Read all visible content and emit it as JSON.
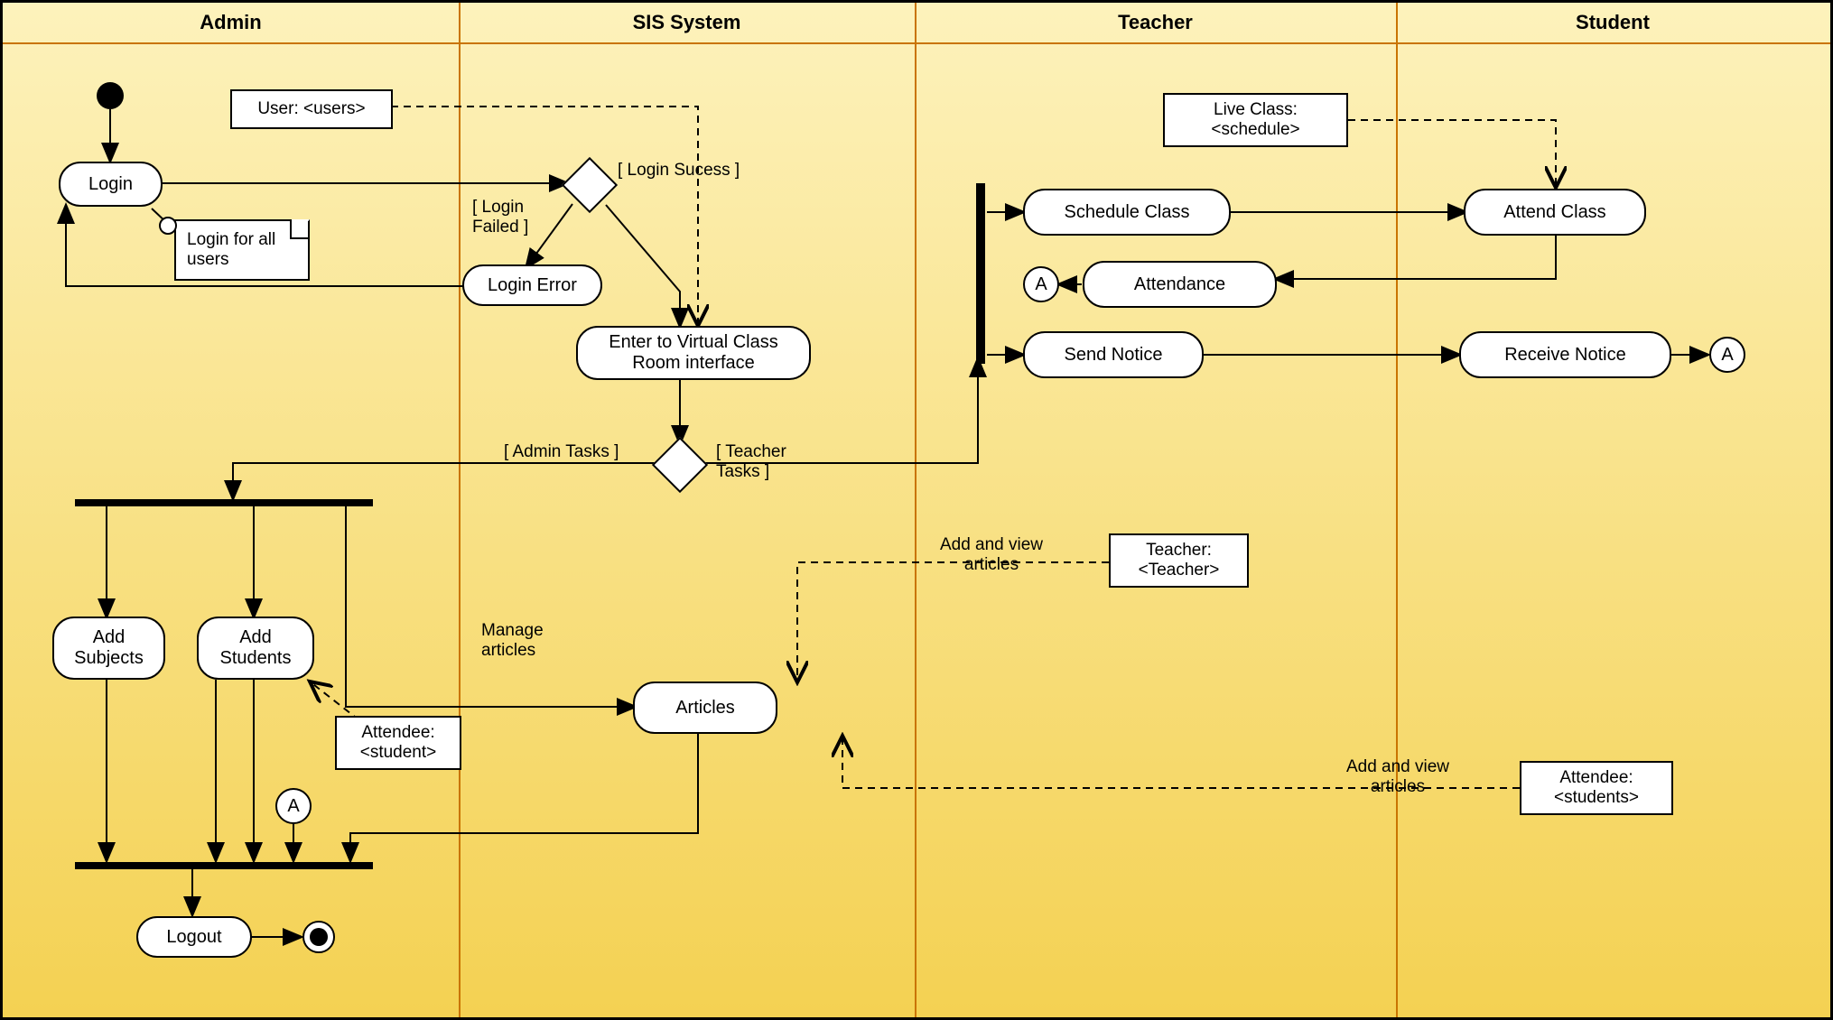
{
  "lanes": {
    "admin": "Admin",
    "sis": "SIS System",
    "teacher": "Teacher",
    "student": "Student"
  },
  "activities": {
    "login": "Login",
    "login_error": "Login Error",
    "enter_vcr": "Enter to Virtual Class Room interface",
    "add_subjects": "Add Subjects",
    "add_students": "Add Students",
    "logout": "Logout",
    "articles": "Articles",
    "schedule_class": "Schedule Class",
    "attendance": "Attendance",
    "send_notice": "Send Notice",
    "attend_class": "Attend Class",
    "receive_notice": "Receive Notice"
  },
  "objects": {
    "user": "User: <users>",
    "live_class": "Live Class: <schedule>",
    "teacher": "Teacher: <Teacher>",
    "attendee_student": "Attendee: <student>",
    "attendee_students": "Attendee: <students>"
  },
  "notes": {
    "login_all": "Login for all users"
  },
  "guards": {
    "login_success": "[ Login Sucess ]",
    "login_failed": "[ Login Failed ]",
    "admin_tasks": "[ Admin Tasks ]",
    "teacher_tasks": "[ Teacher Tasks ]"
  },
  "edge_labels": {
    "manage_articles": "Manage articles",
    "add_view_articles_t": "Add and view articles",
    "add_view_articles_s": "Add and view articles"
  },
  "connector": {
    "A": "A"
  }
}
